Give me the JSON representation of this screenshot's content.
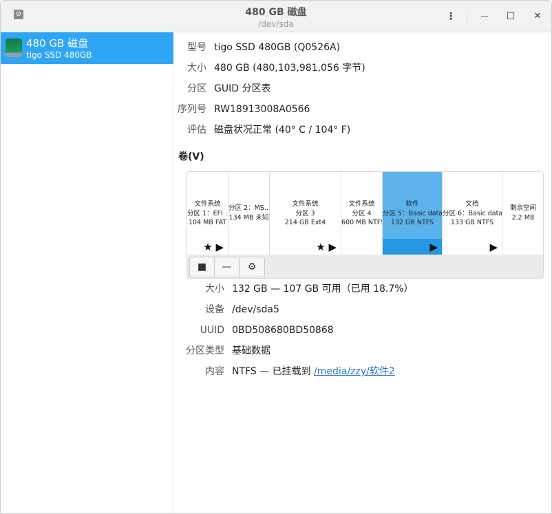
{
  "window": {
    "title": "480 GB 磁盘",
    "subtitle": "/dev/sda",
    "menu_icon": "⋮",
    "minimize_icon": "—",
    "maximize_icon": "☐",
    "close_icon": "✕"
  },
  "sidebar": {
    "disks": [
      {
        "name": "480 GB 磁盘",
        "model": "tigo SSD 480GB"
      }
    ]
  },
  "info": [
    {
      "label": "型号",
      "value": "tigo SSD 480GB (Q0526A)"
    },
    {
      "label": "大小",
      "value": "480 GB (480,103,981,056 字节)"
    },
    {
      "label": "分区",
      "value": "GUID 分区表"
    },
    {
      "label": "序列号",
      "value": "RW18913008A0566"
    },
    {
      "label": "评估",
      "value": "磁盘状况正常 (40° C / 104° F)"
    }
  ],
  "volumes_label": "卷(V)",
  "partitions": [
    {
      "lines": [
        "文件系统",
        "分区 1：EFI …",
        "104 MB FAT"
      ],
      "marks": "★ ▶"
    },
    {
      "lines": [
        "分区 2：MS…",
        "134 MB 未知"
      ],
      "marks": ""
    },
    {
      "lines": [
        "文件系统",
        "分区 3",
        "214 GB Ext4"
      ],
      "marks": "★ ▶"
    },
    {
      "lines": [
        "文件系统",
        "分区 4",
        "600 MB NTFS"
      ],
      "marks": ""
    },
    {
      "lines": [
        "软件",
        "分区 5：Basic data…",
        "132 GB NTFS"
      ],
      "marks": "▶"
    },
    {
      "lines": [
        "文档",
        "分区 6：Basic data…",
        "133 GB NTFS"
      ],
      "marks": "▶"
    },
    {
      "lines": [
        "剩余空间",
        "2.2 MB"
      ],
      "marks": ""
    }
  ],
  "toolbar": {
    "stop": "■",
    "delete": "—",
    "settings": "⚙"
  },
  "details": [
    {
      "label": "大小",
      "value": "132 GB — 107 GB 可用（已用 18.7%）"
    },
    {
      "label": "设备",
      "value": "/dev/sda5"
    },
    {
      "label": "UUID",
      "value": "0BD508680BD50868"
    },
    {
      "label": "分区类型",
      "value": "基础数据"
    },
    {
      "label": "内容",
      "value": "NTFS — 已挂载到 ",
      "link": "/media/zzy/软件2"
    }
  ]
}
